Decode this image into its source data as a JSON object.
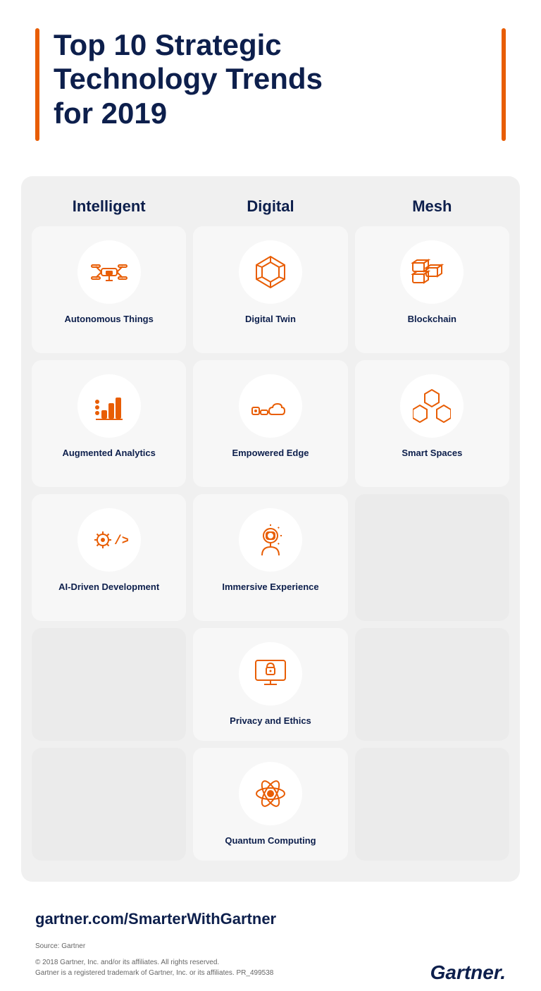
{
  "header": {
    "title_line1": "Top 10 Strategic",
    "title_line2": "Technology Trends",
    "title_line3": "for 2019"
  },
  "columns": [
    {
      "id": "intelligent",
      "label": "Intelligent"
    },
    {
      "id": "digital",
      "label": "Digital"
    },
    {
      "id": "mesh",
      "label": "Mesh"
    }
  ],
  "rows": [
    {
      "cells": [
        {
          "label": "Autonomous\nThings",
          "icon": "drone",
          "empty": false
        },
        {
          "label": "Digital\nTwin",
          "icon": "digital-twin",
          "empty": false
        },
        {
          "label": "Blockchain",
          "icon": "blockchain",
          "empty": false
        }
      ]
    },
    {
      "cells": [
        {
          "label": "Augmented\nAnalytics",
          "icon": "analytics",
          "empty": false
        },
        {
          "label": "Empowered\nEdge",
          "icon": "edge",
          "empty": false
        },
        {
          "label": "Smart\nSpaces",
          "icon": "smart-spaces",
          "empty": false
        }
      ]
    },
    {
      "cells": [
        {
          "label": "AI-Driven\nDevelopment",
          "icon": "ai-dev",
          "empty": false
        },
        {
          "label": "Immersive\nExperience",
          "icon": "immersive",
          "empty": false
        },
        {
          "label": "",
          "icon": "",
          "empty": true
        }
      ]
    }
  ],
  "extra_rows": [
    {
      "label": "Privacy and Ethics",
      "icon": "privacy"
    },
    {
      "label": "Quantum Computing",
      "icon": "quantum"
    }
  ],
  "footer": {
    "website": "gartner.com/SmarterWithGartner",
    "source": "Source: Gartner",
    "copyright": "© 2018 Gartner, Inc. and/or its affiliates. All rights reserved.\nGartner is a registered trademark of Gartner, Inc. or its affiliates. PR_499538",
    "logo": "Gartner."
  }
}
